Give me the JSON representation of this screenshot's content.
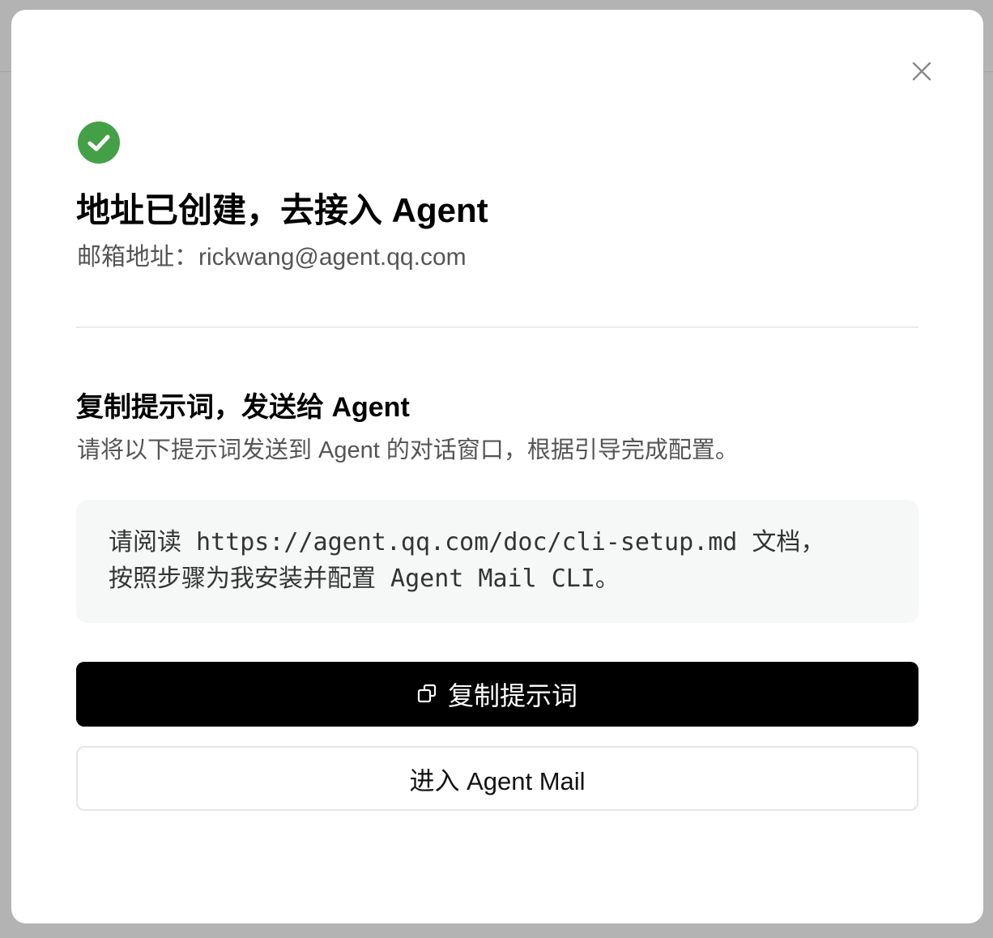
{
  "modal": {
    "title": "地址已创建，去接入 Agent",
    "email_label": "邮箱地址：",
    "email_value": "rickwang@agent.qq.com",
    "close_icon": "close-icon",
    "success_icon": "check-circle-icon",
    "success_color": "#43a047"
  },
  "prompt_section": {
    "title": "复制提示词，发送给 Agent",
    "description": "请将以下提示词发送到 Agent 的对话窗口，根据引导完成配置。",
    "prompt_line_1": "请阅读 https://agent.qq.com/doc/cli-setup.md 文档，",
    "prompt_line_2": "按照步骤为我安装并配置 Agent Mail CLI。"
  },
  "actions": {
    "copy_label": "复制提示词",
    "copy_icon": "copy-icon",
    "enter_label": "进入 Agent Mail"
  }
}
